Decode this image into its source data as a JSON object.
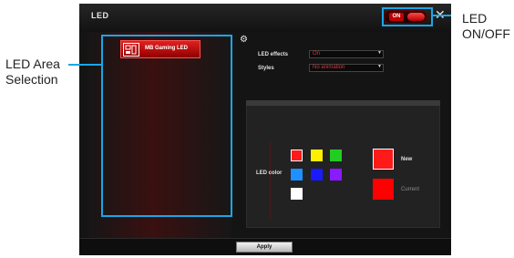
{
  "window": {
    "title": "LED"
  },
  "power_toggle": {
    "label": "ON"
  },
  "led_area": {
    "items": [
      {
        "label": "MB Gaming LED"
      }
    ]
  },
  "settings": {
    "led_effects_label": "LED effects",
    "led_effects_value": "On",
    "styles_label": "Styles",
    "styles_value": "No animation"
  },
  "color_picker": {
    "label": "LED color",
    "palette": [
      "#ff1a1a",
      "#ffee00",
      "#22cc22",
      "#1e90ff",
      "#1a1aff",
      "#8a1aff",
      "#ffffff"
    ],
    "new_label": "New",
    "new_color": "#ff1a1a",
    "current_label": "Current",
    "current_color": "#ff0000"
  },
  "footer": {
    "apply_label": "Apply"
  },
  "annotations": {
    "led_area": [
      "LED Area",
      "Selection"
    ],
    "led_toggle": [
      "LED",
      "ON/OFF"
    ],
    "highlight_color": "#1ba6e6"
  }
}
